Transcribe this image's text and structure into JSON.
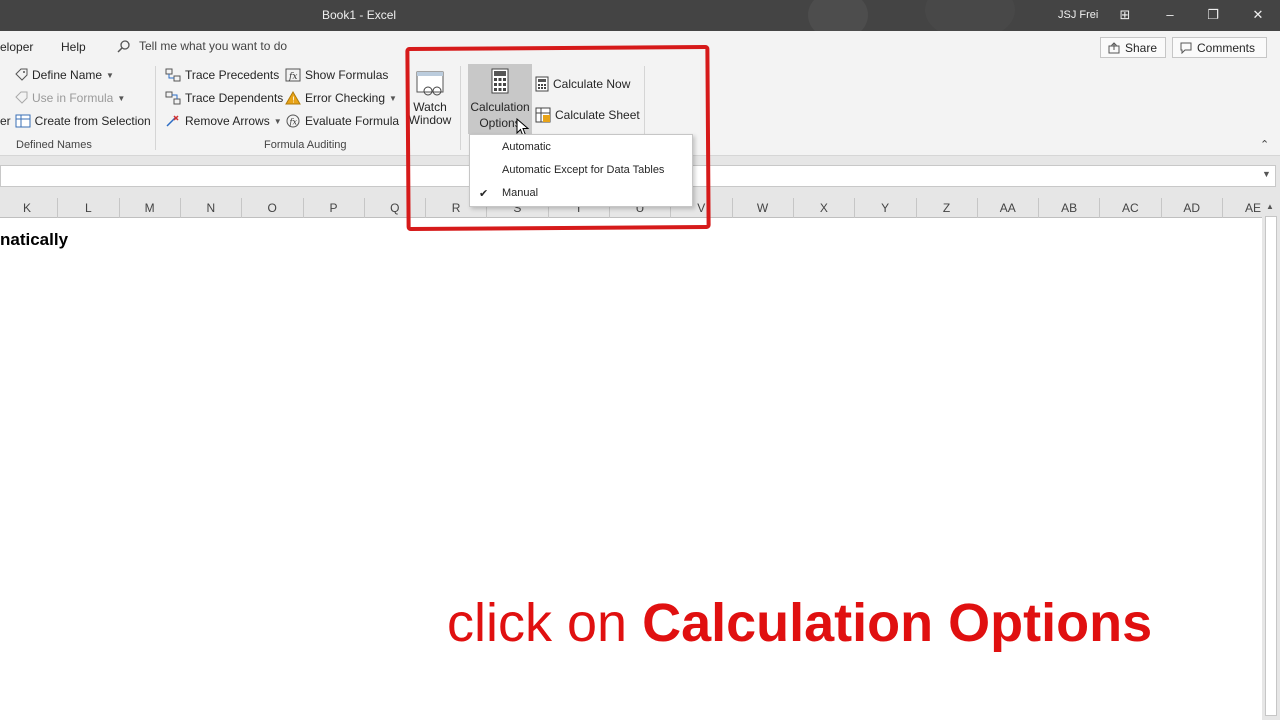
{
  "window": {
    "title": "Book1  -  Excel",
    "user": "JSJ Frei"
  },
  "tabs": {
    "developer": "eloper",
    "help": "Help",
    "tell_me": "Tell me what you want to do"
  },
  "share": {
    "share_label": "Share",
    "comments_label": "Comments"
  },
  "defined_names": {
    "define_name": "Define Name",
    "use_in_formula": "Use in Formula",
    "create_from_selection": "Create from Selection",
    "partial_left": "er",
    "group_label": "Defined Names"
  },
  "formula_auditing": {
    "trace_precedents": "Trace Precedents",
    "trace_dependents": "Trace Dependents",
    "remove_arrows": "Remove Arrows",
    "show_formulas": "Show Formulas",
    "error_checking": "Error Checking",
    "evaluate_formula": "Evaluate Formula",
    "group_label": "Formula Auditing"
  },
  "watch_window": {
    "line1": "Watch",
    "line2": "Window"
  },
  "calculation": {
    "options_line1": "Calculation",
    "options_line2": "Options",
    "calculate_now": "Calculate Now",
    "calculate_sheet": "Calculate Sheet"
  },
  "dropdown": {
    "items": [
      "Automatic",
      "Automatic Except for Data Tables",
      "Manual"
    ],
    "checked": "Manual"
  },
  "columns": [
    "K",
    "L",
    "M",
    "N",
    "O",
    "P",
    "Q",
    "R",
    "S",
    "T",
    "U",
    "V",
    "W",
    "X",
    "Y",
    "Z",
    "AA",
    "AB",
    "AC",
    "AD",
    "AE"
  ],
  "sheet": {
    "cell_text": "natically"
  },
  "caption": {
    "plain": "click on ",
    "bold": "Calculation Options"
  },
  "colors": {
    "annotation_red": "#d61a1a",
    "caption_red": "#e01010",
    "highlight_yellow": "#ffee28"
  },
  "icons": [
    "search-icon",
    "share-icon",
    "comments-icon",
    "define-name-icon",
    "use-in-formula-icon",
    "create-from-selection-icon",
    "trace-precedents-icon",
    "trace-dependents-icon",
    "remove-arrows-icon",
    "show-formulas-icon",
    "error-checking-icon",
    "evaluate-formula-icon",
    "watch-window-icon",
    "calculator-icon",
    "calculate-now-icon",
    "calculate-sheet-icon",
    "check-icon",
    "mouse-cursor-icon"
  ]
}
